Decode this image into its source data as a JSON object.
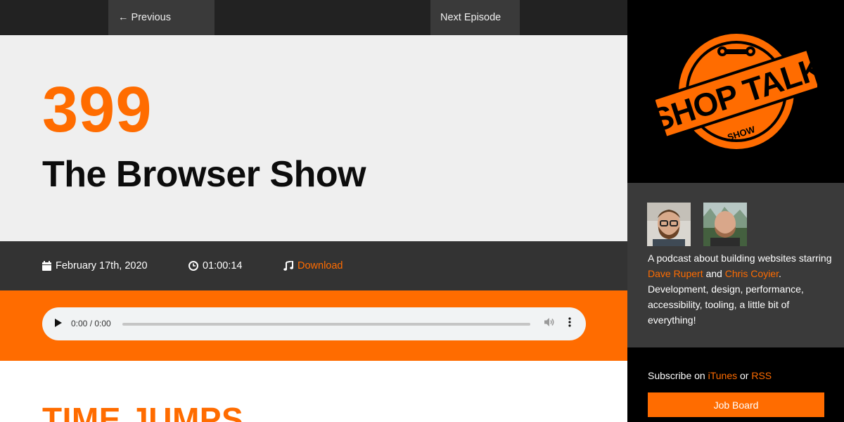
{
  "nav": {
    "previous_label": "← Previous Episode",
    "next_label": "Next Episode →"
  },
  "episode": {
    "number": "399",
    "title": "The Browser Show",
    "date": "February 17th, 2020",
    "duration": "01:00:14",
    "download_label": "Download"
  },
  "player": {
    "time": "0:00 / 0:00",
    "progress": 0
  },
  "content": {
    "section_heading": "TIME JUMPS"
  },
  "sidebar": {
    "logo": {
      "line1": "SHOP TALK",
      "line2": "SHOW"
    },
    "about": {
      "intro": "A podcast about building websites starring ",
      "host1": "Dave Rupert",
      "and": " and ",
      "host2": "Chris Coyier",
      "rest": ". Development, design, performance, accessibility, tooling, a little bit of everything!"
    },
    "subscribe": {
      "prefix": "Subscribe on ",
      "itunes": "iTunes",
      "or": " or ",
      "rss": "RSS"
    },
    "job_board_label": "Job Board"
  },
  "colors": {
    "accent": "#ff6c00",
    "dark_bar": "#333333",
    "hero_bg": "#efefef",
    "sidebar_bg": "#000000",
    "about_bg": "#3a3a3a"
  },
  "icons": {
    "date": "calendar-icon",
    "duration": "clock-icon",
    "download": "music-note-icon",
    "play": "play-icon",
    "volume": "volume-icon",
    "more": "more-vertical-icon"
  }
}
